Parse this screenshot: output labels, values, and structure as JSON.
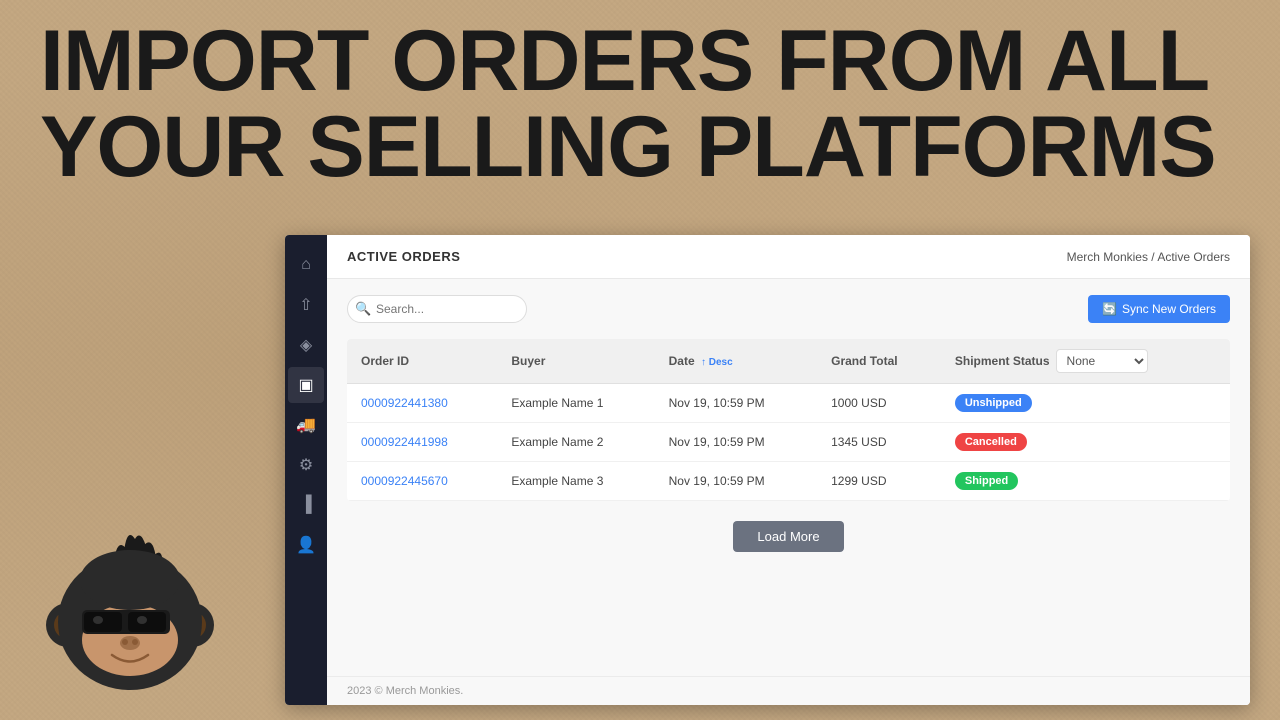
{
  "headline": {
    "line1": "Import Orders from All",
    "line2": "Your Selling Platforms"
  },
  "breadcrumb": {
    "parent": "Merch Monkies",
    "separator": " / ",
    "current": "Active Orders"
  },
  "page": {
    "title": "ACTIVE ORDERS"
  },
  "toolbar": {
    "search_placeholder": "Search...",
    "sync_button_label": "Sync New Orders"
  },
  "table": {
    "columns": [
      {
        "id": "order_id",
        "label": "Order ID"
      },
      {
        "id": "buyer",
        "label": "Buyer"
      },
      {
        "id": "date",
        "label": "Date",
        "sort": "↑ Desc"
      },
      {
        "id": "grand_total",
        "label": "Grand Total"
      },
      {
        "id": "shipment_status",
        "label": "Shipment Status"
      }
    ],
    "shipment_filter_default": "None",
    "rows": [
      {
        "order_id": "0000922441380",
        "buyer": "Example Name 1",
        "date": "Nov 19, 10:59 PM",
        "grand_total": "1000 USD",
        "shipment_status": "Unshipped",
        "status_class": "unshipped"
      },
      {
        "order_id": "0000922441998",
        "buyer": "Example Name 2",
        "date": "Nov 19, 10:59 PM",
        "grand_total": "1345 USD",
        "shipment_status": "Cancelled",
        "status_class": "cancelled"
      },
      {
        "order_id": "0000922445670",
        "buyer": "Example Name 3",
        "date": "Nov 19, 10:59 PM",
        "grand_total": "1299 USD",
        "shipment_status": "Shipped",
        "status_class": "shipped"
      }
    ]
  },
  "load_more_label": "Load More",
  "footer": {
    "text": "2023 © Merch Monkies."
  },
  "sidebar": {
    "items": [
      {
        "icon": "🏠",
        "name": "home",
        "active": false
      },
      {
        "icon": "⬆",
        "name": "upload",
        "active": false
      },
      {
        "icon": "🏷",
        "name": "tags",
        "active": false
      },
      {
        "icon": "📋",
        "name": "orders",
        "active": true
      },
      {
        "icon": "🚚",
        "name": "shipping",
        "active": false
      },
      {
        "icon": "⚙",
        "name": "settings",
        "active": false
      },
      {
        "icon": "📊",
        "name": "analytics",
        "active": false
      },
      {
        "icon": "👤",
        "name": "account",
        "active": false
      }
    ]
  },
  "colors": {
    "accent_blue": "#3b82f6",
    "badge_unshipped": "#3b82f6",
    "badge_cancelled": "#ef4444",
    "badge_shipped": "#22c55e",
    "sidebar_bg": "#1a1e2e",
    "load_more_bg": "#6b7280"
  }
}
